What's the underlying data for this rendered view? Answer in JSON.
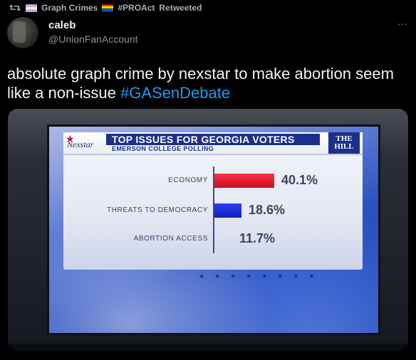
{
  "retweet": {
    "icon": "retweet-icon",
    "source": "Graph Crimes",
    "tag": "#PROAct",
    "suffix": "Retweeted"
  },
  "tweet": {
    "display_name": "caleb",
    "handle": "@UnionFanAccount",
    "text_plain": "absolute graph crime by nexstar to make abortion seem like a non-issue",
    "hashtag": "#GASenDebate",
    "more_icon": "more-icon"
  },
  "media": {
    "logo_left": "Nexstar",
    "title": "TOP ISSUES FOR GEORGIA VOTERS",
    "subtitle": "EMERSON COLLEGE POLLING",
    "logo_right_line1": "THE",
    "logo_right_line2": "HILL",
    "stars": "★★★★★★★★",
    "chart_data": {
      "type": "bar",
      "title": "TOP ISSUES FOR GEORGIA VOTERS",
      "subtitle": "EMERSON COLLEGE POLLING",
      "orientation": "horizontal",
      "categories": [
        "ECONOMY",
        "THREATS TO DEMOCRACY",
        "ABORTION ACCESS"
      ],
      "values": [
        40.1,
        18.6,
        11.7
      ],
      "value_labels": [
        "40.1%",
        "18.6%",
        "11.7%"
      ],
      "bar_colors": [
        "#e0162b",
        "#1a28d8",
        "none"
      ]
    }
  },
  "colors": {
    "background": "#000000",
    "text": "#e7e9ea",
    "hashtag": "#1d9bf0",
    "panel_title_band": "#1c2f8c"
  }
}
